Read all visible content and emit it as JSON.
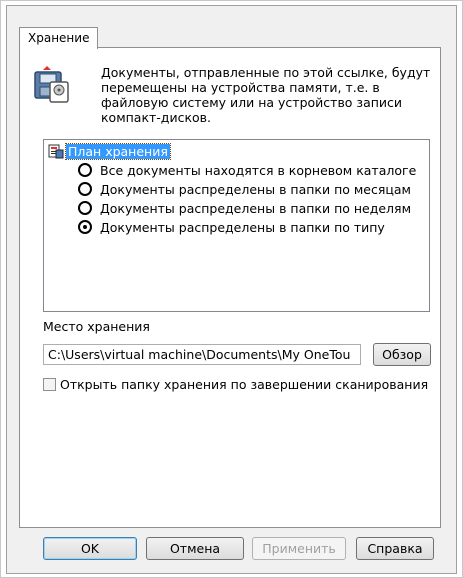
{
  "tab": {
    "label": "Хранение"
  },
  "description": "Документы, отправленные по этой ссылке, будут перемещены на устройства памяти, т.е. в файловую систему или на устройство записи компакт-дисков.",
  "tree": {
    "root_label": "План хранения",
    "options": [
      {
        "label": "Все документы находятся в корневом каталоге",
        "selected": false
      },
      {
        "label": "Документы распределены в папки по месяцам",
        "selected": false
      },
      {
        "label": "Документы распределены в папки по неделям",
        "selected": false
      },
      {
        "label": "Документы распределены в папки по типу",
        "selected": true
      }
    ]
  },
  "location": {
    "label": "Место хранения",
    "path": "C:\\Users\\virtual machine\\Documents\\My OneTou",
    "browse_label": "Обзор"
  },
  "open_folder_checkbox": {
    "label": "Открыть папку хранения по завершении сканирования",
    "checked": false
  },
  "buttons": {
    "ok": "OK",
    "cancel": "Отмена",
    "apply": "Применить",
    "help": "Справка"
  }
}
